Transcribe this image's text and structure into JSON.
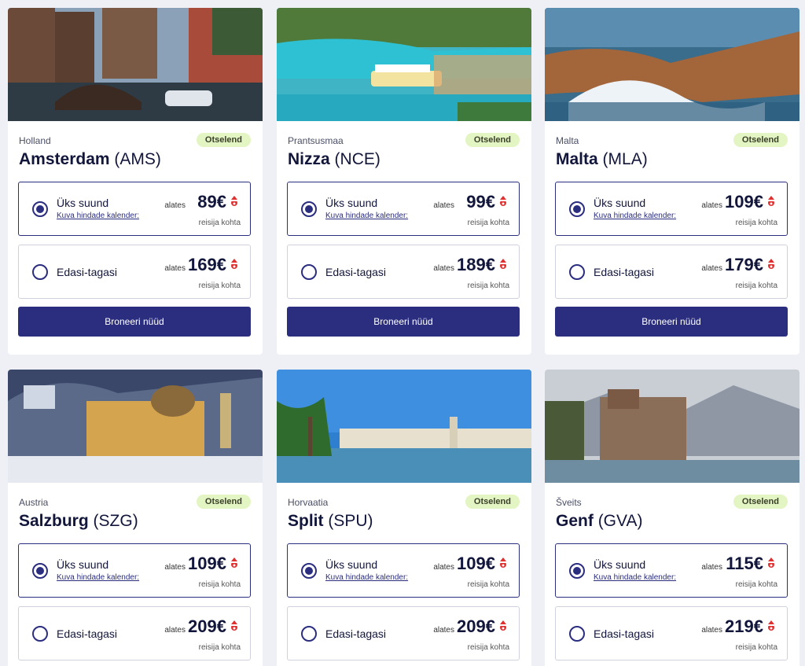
{
  "cards": [
    {
      "country": "Holland",
      "city": "Amsterdam",
      "code": "(AMS)",
      "badge": "Otselend",
      "one_way": {
        "label": "Üks suund",
        "link": "Kuva hindade kalender:",
        "from": "alates",
        "price": "89€",
        "per": "reisija kohta"
      },
      "round_trip": {
        "label": "Edasi-tagasi",
        "from": "alates",
        "price": "169€",
        "per": "reisija kohta"
      },
      "book": "Broneeri nüüd"
    },
    {
      "country": "Prantsusmaa",
      "city": "Nizza",
      "code": "(NCE)",
      "badge": "Otselend",
      "one_way": {
        "label": "Üks suund",
        "link": "Kuva hindade kalender:",
        "from": "alates",
        "price": "99€",
        "per": "reisija kohta"
      },
      "round_trip": {
        "label": "Edasi-tagasi",
        "from": "alates",
        "price": "189€",
        "per": "reisija kohta"
      },
      "book": "Broneeri nüüd"
    },
    {
      "country": "Malta",
      "city": "Malta",
      "code": "(MLA)",
      "badge": "Otselend",
      "one_way": {
        "label": "Üks suund",
        "link": "Kuva hindade kalender:",
        "from": "alates",
        "price": "109€",
        "per": "reisija kohta"
      },
      "round_trip": {
        "label": "Edasi-tagasi",
        "from": "alates",
        "price": "179€",
        "per": "reisija kohta"
      },
      "book": "Broneeri nüüd"
    },
    {
      "country": "Austria",
      "city": "Salzburg",
      "code": "(SZG)",
      "badge": "Otselend",
      "one_way": {
        "label": "Üks suund",
        "link": "Kuva hindade kalender:",
        "from": "alates",
        "price": "109€",
        "per": "reisija kohta"
      },
      "round_trip": {
        "label": "Edasi-tagasi",
        "from": "alates",
        "price": "209€",
        "per": "reisija kohta"
      }
    },
    {
      "country": "Horvaatia",
      "city": "Split",
      "code": "(SPU)",
      "badge": "Otselend",
      "one_way": {
        "label": "Üks suund",
        "link": "Kuva hindade kalender:",
        "from": "alates",
        "price": "109€",
        "per": "reisija kohta"
      },
      "round_trip": {
        "label": "Edasi-tagasi",
        "from": "alates",
        "price": "209€",
        "per": "reisija kohta"
      }
    },
    {
      "country": "Šveits",
      "city": "Genf",
      "code": "(GVA)",
      "badge": "Otselend",
      "one_way": {
        "label": "Üks suund",
        "link": "Kuva hindade kalender:",
        "from": "alates",
        "price": "115€",
        "per": "reisija kohta"
      },
      "round_trip": {
        "label": "Edasi-tagasi",
        "from": "alates",
        "price": "219€",
        "per": "reisija kohta"
      }
    }
  ],
  "colors": {
    "primary": "#2b2e7f",
    "badge_bg": "#e3f5c2",
    "page_bg": "#eef0f5",
    "price_icon": "#e03030"
  },
  "icons": {
    "price_icon": "santa-hat-icon",
    "radio_selected": "radio-selected-icon",
    "radio_unselected": "radio-unselected-icon"
  }
}
